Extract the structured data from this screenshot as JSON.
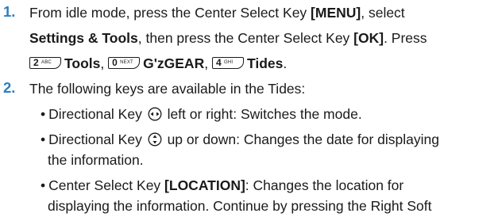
{
  "step1": {
    "number": "1.",
    "line1_text": "From idle mode, press the Center Select Key ",
    "line1_key": "[MENU]",
    "line1_end": ", select",
    "line2_bold": "Settings & Tools",
    "line2_text": ", then press the Center Select Key ",
    "line2_key": "[OK]",
    "line2_end": ". Press",
    "key_tools": {
      "digit": "2",
      "letters": "ABC",
      "label": "Tools"
    },
    "key_gzgear": {
      "digit": "0",
      "letters": "NEXT",
      "label": "G'zGEAR"
    },
    "key_tides": {
      "digit": "4",
      "letters": "GHI",
      "label": "Tides"
    },
    "comma": ",",
    "period": "."
  },
  "step2": {
    "number": "2.",
    "intro": "The following keys are available in the Tides:",
    "bullet_char": "•",
    "bullet1": {
      "pre": "Directional Key ",
      "icon": "left-right-directional-icon",
      "post": " left or right: Switches the mode."
    },
    "bullet2": {
      "pre": "Directional Key ",
      "icon": "up-down-directional-icon",
      "post": " up or down: Changes the date for displaying",
      "cont": "the information."
    },
    "bullet3": {
      "pre": "Center Select Key ",
      "key": "[LOCATION]",
      "post": ": Changes the location for",
      "cont": "displaying the information. Continue by pressing the Right Soft"
    }
  },
  "colors": {
    "step_number": "#2a7fc0",
    "text": "#1a1a1a"
  }
}
